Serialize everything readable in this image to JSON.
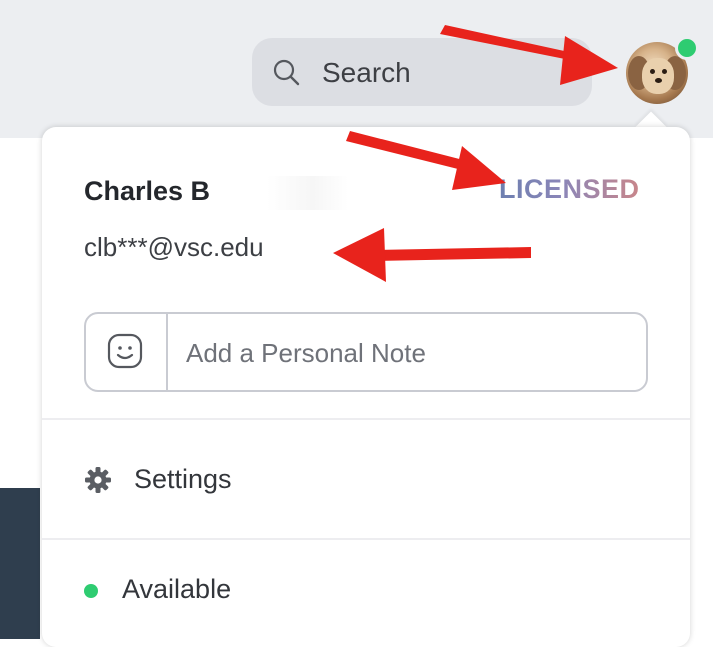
{
  "header": {
    "search_label": "Search",
    "search_icon": "search-icon",
    "avatar_icon": "avatar-dog-photo",
    "presence_color": "#2ecc71"
  },
  "profile": {
    "name": "Charles B",
    "license": "LICENSED",
    "email": "clb***@vsc.edu"
  },
  "note": {
    "icon": "smiley-icon",
    "placeholder": "Add a Personal Note"
  },
  "menu": {
    "settings_label": "Settings",
    "settings_icon": "gear-icon",
    "status_label": "Available",
    "status_color": "#2ecc71"
  },
  "annotations": {
    "arrow_color": "#e8231c"
  }
}
